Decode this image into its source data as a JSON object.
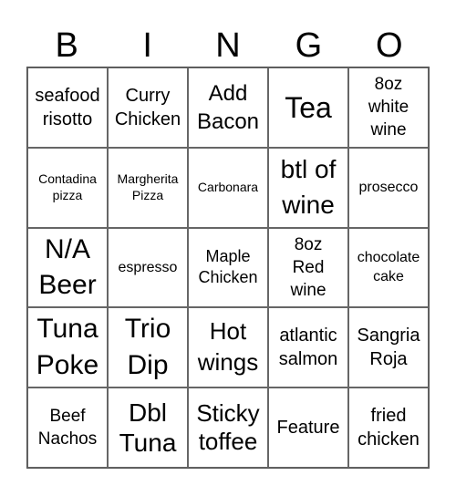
{
  "header": {
    "letters": [
      "B",
      "I",
      "N",
      "G",
      "O"
    ]
  },
  "cells": [
    [
      "seafood risotto",
      "Curry Chicken",
      "Add Bacon",
      "Tea",
      "8oz white wine"
    ],
    [
      "Contadina pizza",
      "Margherita Pizza",
      "Carbonara",
      "btl of wine",
      "prosecco"
    ],
    [
      "N/A Beer",
      "espresso",
      "Maple Chicken",
      "8oz Red wine",
      "chocolate cake"
    ],
    [
      "Tuna Poke",
      "Trio Dip",
      "Hot wings",
      "atlantic salmon",
      "Sangria Roja"
    ],
    [
      "Beef Nachos",
      "Dbl Tuna",
      "Sticky toffee",
      "Feature",
      "fried chicken"
    ]
  ],
  "colors": {
    "grid_line": "#666666",
    "text": "#000000",
    "background": "#ffffff"
  }
}
